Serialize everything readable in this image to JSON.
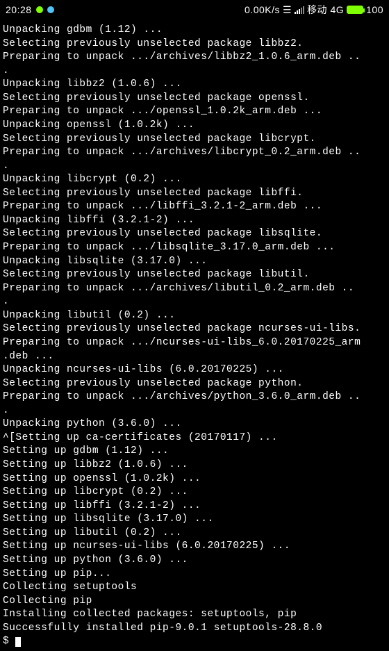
{
  "statusbar": {
    "time": "20:28",
    "speed": "0.00K/s",
    "carrier": "移动 4G",
    "battery": "100"
  },
  "terminal": {
    "lines": [
      "Unpacking gdbm (1.12) ...",
      "Selecting previously unselected package libbz2.",
      "Preparing to unpack .../archives/libbz2_1.0.6_arm.deb ..",
      ".",
      "Unpacking libbz2 (1.0.6) ...",
      "Selecting previously unselected package openssl.",
      "Preparing to unpack .../openssl_1.0.2k_arm.deb ...",
      "Unpacking openssl (1.0.2k) ...",
      "Selecting previously unselected package libcrypt.",
      "Preparing to unpack .../archives/libcrypt_0.2_arm.deb ..",
      ".",
      "Unpacking libcrypt (0.2) ...",
      "Selecting previously unselected package libffi.",
      "Preparing to unpack .../libffi_3.2.1-2_arm.deb ...",
      "Unpacking libffi (3.2.1-2) ...",
      "Selecting previously unselected package libsqlite.",
      "Preparing to unpack .../libsqlite_3.17.0_arm.deb ...",
      "Unpacking libsqlite (3.17.0) ...",
      "Selecting previously unselected package libutil.",
      "Preparing to unpack .../archives/libutil_0.2_arm.deb ..",
      ".",
      "Unpacking libutil (0.2) ...",
      "Selecting previously unselected package ncurses-ui-libs.",
      "Preparing to unpack .../ncurses-ui-libs_6.0.20170225_arm",
      ".deb ...",
      "Unpacking ncurses-ui-libs (6.0.20170225) ...",
      "Selecting previously unselected package python.",
      "Preparing to unpack .../archives/python_3.6.0_arm.deb ..",
      ".",
      "Unpacking python (3.6.0) ...",
      "^[Setting up ca-certificates (20170117) ...",
      "Setting up gdbm (1.12) ...",
      "Setting up libbz2 (1.0.6) ...",
      "Setting up openssl (1.0.2k) ...",
      "Setting up libcrypt (0.2) ...",
      "Setting up libffi (3.2.1-2) ...",
      "Setting up libsqlite (3.17.0) ...",
      "Setting up libutil (0.2) ...",
      "Setting up ncurses-ui-libs (6.0.20170225) ...",
      "Setting up python (3.6.0) ...",
      "Setting up pip...",
      "Collecting setuptools",
      "Collecting pip",
      "Installing collected packages: setuptools, pip",
      "Successfully installed pip-9.0.1 setuptools-28.8.0"
    ],
    "prompt": "$ "
  }
}
